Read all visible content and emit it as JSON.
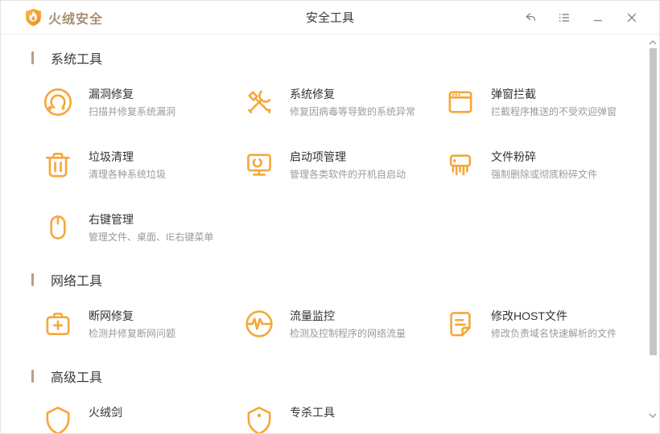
{
  "window": {
    "app_name": "火绒安全",
    "page_title": "安全工具"
  },
  "colors": {
    "accent_orange": "#F6A73A",
    "brand_text": "#A79072",
    "section_bar": "#B5A183",
    "desc_text": "#9B9B9B",
    "title_text": "#333333"
  },
  "titlebar": {
    "controls": [
      {
        "name": "back",
        "icon": "back-arrow-icon"
      },
      {
        "name": "menu",
        "icon": "menu-list-icon"
      },
      {
        "name": "minimize",
        "icon": "minimize-icon"
      },
      {
        "name": "close",
        "icon": "close-icon"
      }
    ]
  },
  "sections": [
    {
      "label": "系统工具",
      "tools": [
        {
          "icon": "lifebuoy-scan-icon",
          "title": "漏洞修复",
          "desc": "扫描并修复系统漏洞"
        },
        {
          "icon": "wrench-screwdriver-icon",
          "title": "系统修复",
          "desc": "修复因病毒等导致的系统异常"
        },
        {
          "icon": "popup-window-icon",
          "title": "弹窗拦截",
          "desc": "拦截程序推送的不受欢迎弹窗"
        },
        {
          "icon": "trash-icon",
          "title": "垃圾清理",
          "desc": "清理各种系统垃圾"
        },
        {
          "icon": "monitor-power-icon",
          "title": "启动项管理",
          "desc": "管理各类软件的开机自启动"
        },
        {
          "icon": "shredder-icon",
          "title": "文件粉碎",
          "desc": "强制删除或彻底粉碎文件"
        },
        {
          "icon": "mouse-icon",
          "title": "右键管理",
          "desc": "管理文件、桌面、IE右键菜单"
        }
      ]
    },
    {
      "label": "网络工具",
      "tools": [
        {
          "icon": "medkit-icon",
          "title": "断网修复",
          "desc": "检测并修复断网问题"
        },
        {
          "icon": "pulse-circle-icon",
          "title": "流量监控",
          "desc": "检测及控制程序的网络流量"
        },
        {
          "icon": "document-edit-icon",
          "title": "修改HOST文件",
          "desc": "修改负责域名快速解析的文件"
        }
      ]
    },
    {
      "label": "高级工具",
      "tools": [
        {
          "icon": "shield-icon",
          "title": "火绒剑"
        },
        {
          "icon": "shield-dot-icon",
          "title": "专杀工具"
        }
      ]
    }
  ]
}
